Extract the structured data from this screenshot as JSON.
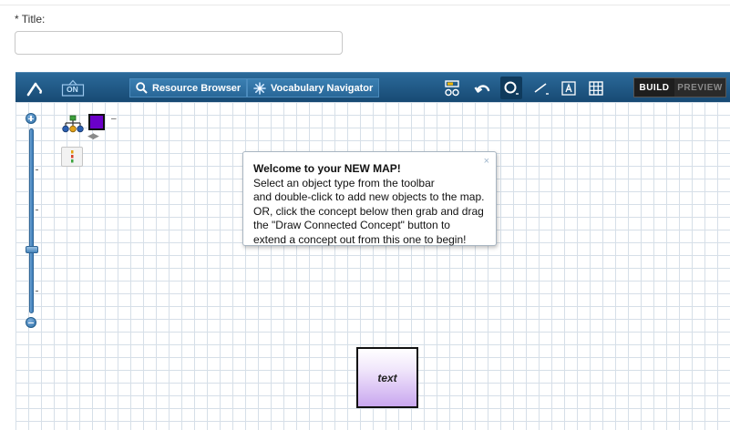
{
  "form": {
    "title_label": "* Title:",
    "title_value": "",
    "title_placeholder": ""
  },
  "toolbar": {
    "resource_browser_label": "Resource Browser",
    "vocabulary_navigator_label": "Vocabulary Navigator",
    "toggle_badge": "ON",
    "mode_build": "BUILD",
    "mode_preview": "PREVIEW",
    "active_mode": "BUILD",
    "active_tool": "draw-concept",
    "icons": [
      "magic-wand-icon",
      "toggle-on-icon",
      "search-icon",
      "vocabulary-icon",
      "layout-icon",
      "undo-icon",
      "concept-tool-icon",
      "line-tool-icon",
      "text-tool-icon",
      "grid-icon"
    ],
    "colors": {
      "toolbar_top": "#2b6a9a",
      "toolbar_bottom": "#174a73",
      "accent": "#6a00c8"
    }
  },
  "sidepanel": {
    "swatch_dash": "–",
    "swatch_color": "#6a00c8",
    "icons": [
      "zoom-in-icon",
      "zoom-out-icon",
      "hierarchy-icon",
      "palette-icon"
    ]
  },
  "zoom": {
    "level": 0.35
  },
  "welcome": {
    "title": "Welcome to your NEW MAP!",
    "lines": [
      "Select an object type from the toolbar",
      "and double-click to add new objects to the map.",
      "OR, click the concept below then grab and drag",
      "the \"Draw Connected Concept\" button to",
      "extend a concept out from this one to begin!"
    ],
    "close": "×"
  },
  "canvas": {
    "node_label": "text",
    "grid": true
  }
}
